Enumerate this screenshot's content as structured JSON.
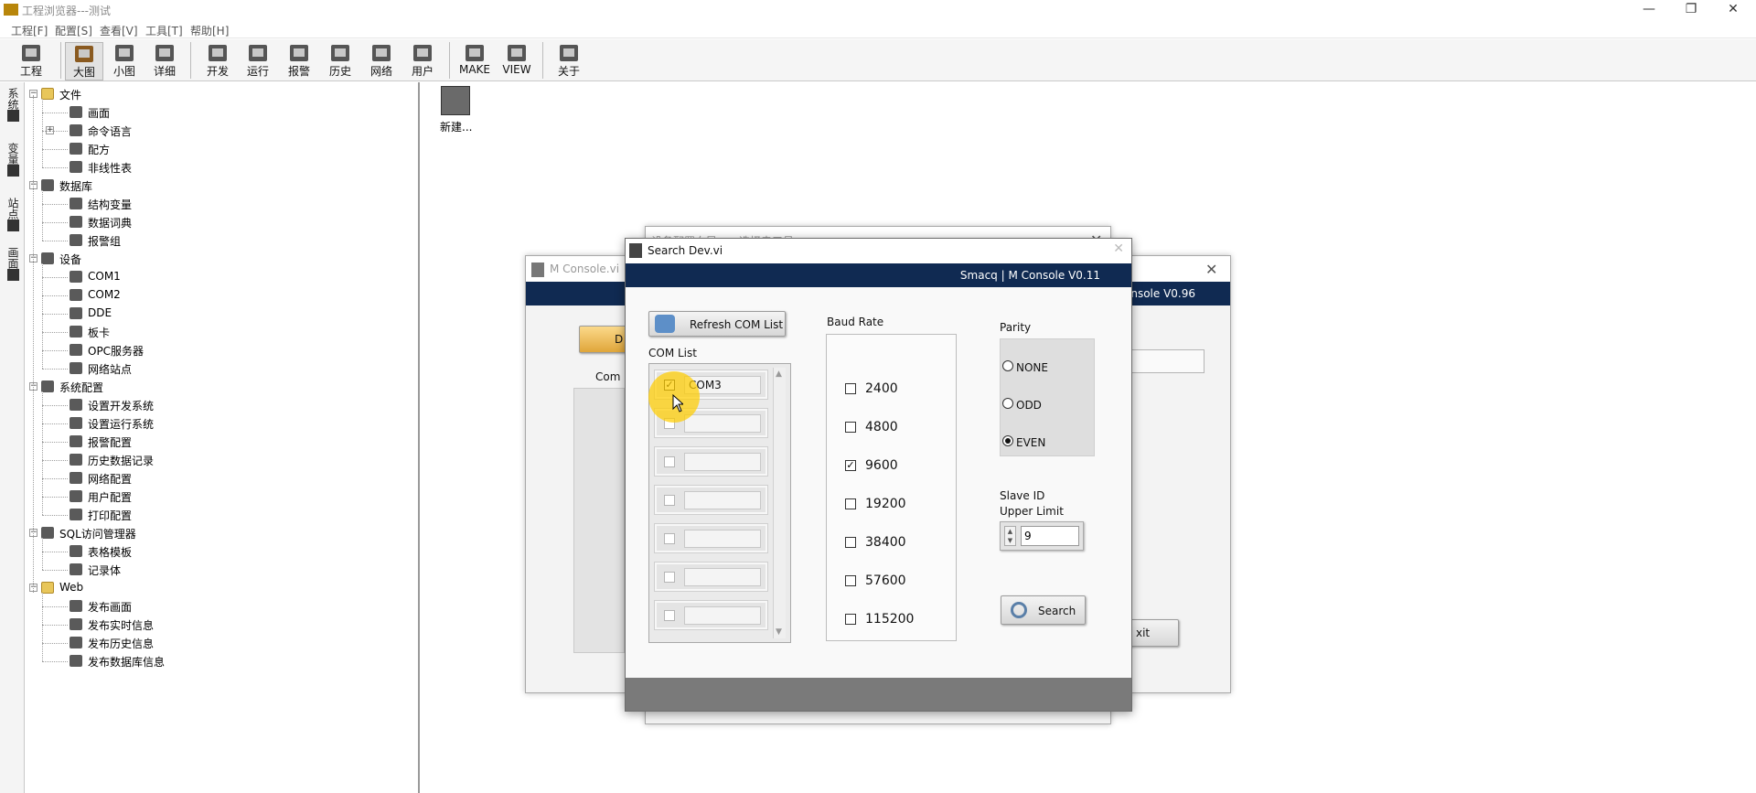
{
  "app": {
    "title": "工程浏览器---测试",
    "controls": {
      "minimize": "—",
      "restore": "❐",
      "close": "✕"
    }
  },
  "menu": [
    "工程[F]",
    "配置[S]",
    "查看[V]",
    "工具[T]",
    "帮助[H]"
  ],
  "toolbar": [
    "工程",
    "大图",
    "小图",
    "详细",
    "开发",
    "运行",
    "报警",
    "历史",
    "网络",
    "用户",
    "MAKE",
    "VIEW",
    "关于"
  ],
  "vtabs": [
    "系统",
    "变量",
    "站点",
    "画面"
  ],
  "tree": [
    {
      "label": "文件",
      "level": 0,
      "exp": "−",
      "icon": "folder"
    },
    {
      "label": "画面",
      "level": 1
    },
    {
      "label": "命令语言",
      "level": 1,
      "exp": "+"
    },
    {
      "label": "配方",
      "level": 1
    },
    {
      "label": "非线性表",
      "level": 1
    },
    {
      "label": "数据库",
      "level": 0,
      "exp": "−"
    },
    {
      "label": "结构变量",
      "level": 1
    },
    {
      "label": "数据词典",
      "level": 1
    },
    {
      "label": "报警组",
      "level": 1
    },
    {
      "label": "设备",
      "level": 0,
      "exp": "−"
    },
    {
      "label": "COM1",
      "level": 1
    },
    {
      "label": "COM2",
      "level": 1
    },
    {
      "label": "DDE",
      "level": 1
    },
    {
      "label": "板卡",
      "level": 1
    },
    {
      "label": "OPC服务器",
      "level": 1
    },
    {
      "label": "网络站点",
      "level": 1
    },
    {
      "label": "系统配置",
      "level": 0,
      "exp": "−"
    },
    {
      "label": "设置开发系统",
      "level": 1
    },
    {
      "label": "设置运行系统",
      "level": 1
    },
    {
      "label": "报警配置",
      "level": 1
    },
    {
      "label": "历史数据记录",
      "level": 1
    },
    {
      "label": "网络配置",
      "level": 1
    },
    {
      "label": "用户配置",
      "level": 1
    },
    {
      "label": "打印配置",
      "level": 1
    },
    {
      "label": "SQL访问管理器",
      "level": 0,
      "exp": "−"
    },
    {
      "label": "表格模板",
      "level": 1
    },
    {
      "label": "记录体",
      "level": 1
    },
    {
      "label": "Web",
      "level": 0,
      "exp": "−",
      "icon": "folder"
    },
    {
      "label": "发布画面",
      "level": 1
    },
    {
      "label": "发布实时信息",
      "level": 1
    },
    {
      "label": "发布历史信息",
      "level": 1
    },
    {
      "label": "发布数据库信息",
      "level": 1
    }
  ],
  "workspace": {
    "item_label": "新建..."
  },
  "bg_windows": {
    "wizard_title": "设备配置向导——选择串口号",
    "console_title": "M Console.vi",
    "console_banner": "onsole V0.96",
    "console_btn": "D",
    "console_com_label": "Com",
    "console_exit": "xit"
  },
  "dialog": {
    "title": "Search Dev.vi",
    "banner": "Smacq | M Console V0.11",
    "refresh_button": "Refresh COM List",
    "com_list_label": "COM List",
    "com_items": [
      "COM3",
      "",
      "",
      "",
      "",
      "",
      ""
    ],
    "com_checked": [
      true,
      false,
      false,
      false,
      false,
      false,
      false
    ],
    "baud_label": "Baud Rate",
    "baud_rates": [
      "2400",
      "4800",
      "9600",
      "19200",
      "38400",
      "57600",
      "115200"
    ],
    "baud_checked": [
      false,
      false,
      true,
      false,
      false,
      false,
      false
    ],
    "parity_label": "Parity",
    "parity_options": [
      "NONE",
      "ODD",
      "EVEN"
    ],
    "parity_selected": "EVEN",
    "slave_label_1": "Slave ID",
    "slave_label_2": "Upper Limit",
    "slave_value": "9",
    "search_button": "Search"
  }
}
